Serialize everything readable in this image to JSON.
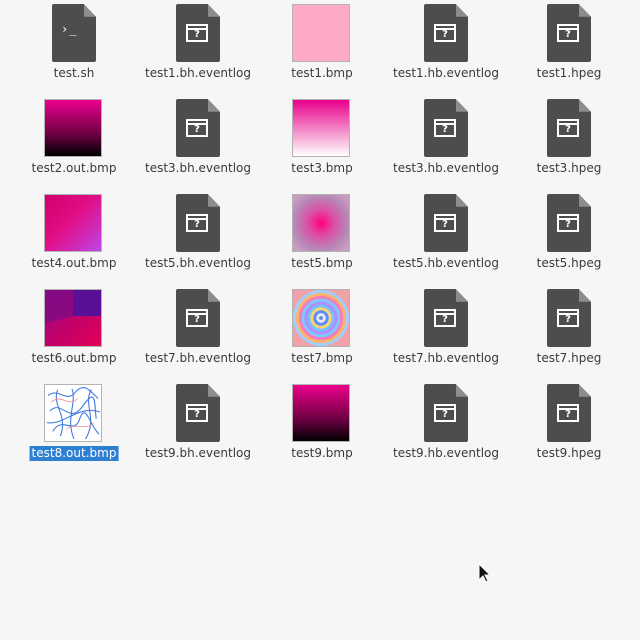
{
  "file_manager": {
    "files": [
      {
        "name": "test.sh",
        "icon": "terminal-script-icon"
      },
      {
        "name": "test1.bh.eventlog",
        "icon": "unknown-file-icon"
      },
      {
        "name": "test1.bmp",
        "icon": "solid-pink-thumbnail"
      },
      {
        "name": "test1.hb.eventlog",
        "icon": "unknown-file-icon"
      },
      {
        "name": "test1.hpeg",
        "icon": "unknown-file-icon"
      },
      {
        "name": "test2.out.bmp",
        "icon": "magenta-black-gradient-thumbnail"
      },
      {
        "name": "test3.bh.eventlog",
        "icon": "unknown-file-icon"
      },
      {
        "name": "test3.bmp",
        "icon": "magenta-white-gradient-thumbnail"
      },
      {
        "name": "test3.hb.eventlog",
        "icon": "unknown-file-icon"
      },
      {
        "name": "test3.hpeg",
        "icon": "unknown-file-icon"
      },
      {
        "name": "test4.out.bmp",
        "icon": "magenta-purple-diagonal-thumbnail"
      },
      {
        "name": "test5.bh.eventlog",
        "icon": "unknown-file-icon"
      },
      {
        "name": "test5.bmp",
        "icon": "radial-pink-thumbnail"
      },
      {
        "name": "test5.hb.eventlog",
        "icon": "unknown-file-icon"
      },
      {
        "name": "test5.hpeg",
        "icon": "unknown-file-icon"
      },
      {
        "name": "test6.out.bmp",
        "icon": "purple-magenta-block-thumbnail"
      },
      {
        "name": "test7.bh.eventlog",
        "icon": "unknown-file-icon"
      },
      {
        "name": "test7.bmp",
        "icon": "concentric-rings-thumbnail"
      },
      {
        "name": "test7.hb.eventlog",
        "icon": "unknown-file-icon"
      },
      {
        "name": "test7.hpeg",
        "icon": "unknown-file-icon"
      },
      {
        "name": "test8.out.bmp",
        "icon": "blue-scribble-thumbnail",
        "selected": true
      },
      {
        "name": "test9.bh.eventlog",
        "icon": "unknown-file-icon"
      },
      {
        "name": "test9.bmp",
        "icon": "magenta-black-gradient-thumbnail"
      },
      {
        "name": "test9.hb.eventlog",
        "icon": "unknown-file-icon"
      },
      {
        "name": "test9.hpeg",
        "icon": "unknown-file-icon"
      }
    ]
  },
  "colors": {
    "background": "#f6f6f6",
    "text": "#3a3a3a",
    "selection": "#2d7fd2",
    "document_icon": "#4d4d4d",
    "pink": "#ffa9c9",
    "magenta": "#e8008d",
    "purple": "#5a1096"
  }
}
